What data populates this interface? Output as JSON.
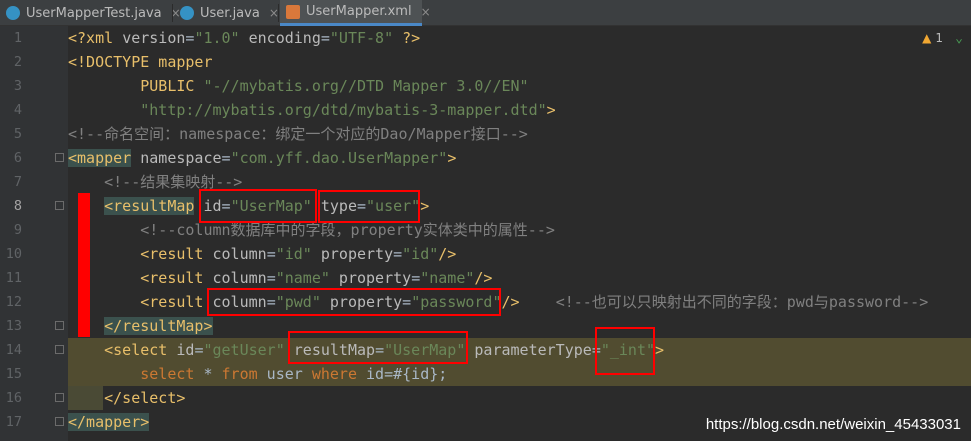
{
  "tabs": [
    {
      "label": "UserMapperTest.java",
      "icon": "java-class-icon",
      "active": false
    },
    {
      "label": "User.java",
      "icon": "java-class-icon",
      "active": false
    },
    {
      "label": "UserMapper.xml",
      "icon": "xml-file-icon",
      "active": true
    }
  ],
  "close_glyph": "×",
  "inspection": {
    "count": "1"
  },
  "line_numbers": [
    "1",
    "2",
    "3",
    "4",
    "5",
    "6",
    "7",
    "8",
    "9",
    "10",
    "11",
    "12",
    "13",
    "14",
    "15",
    "16",
    "17"
  ],
  "code": {
    "l1": {
      "pi_open": "<?xml ",
      "a1": "version",
      "v1": "\"1.0\"",
      "a2": " encoding",
      "v2": "\"UTF-8\"",
      "pi_close": " ?>"
    },
    "l2": {
      "text": "<!DOCTYPE mapper"
    },
    "l3": {
      "indent": "        ",
      "kw": "PUBLIC ",
      "str": "\"-//mybatis.org//DTD Mapper 3.0//EN\""
    },
    "l4": {
      "indent": "        ",
      "str": "\"http://mybatis.org/dtd/mybatis-3-mapper.dtd\"",
      "close": ">"
    },
    "l5": {
      "comment": "<!--命名空间：namespace：绑定一个对应的Dao/Mapper接口-->"
    },
    "l6": {
      "open": "<mapper",
      "attr": " namespace",
      "eq": "=",
      "val": "\"com.yff.dao.UserMapper\"",
      "close": ">"
    },
    "l7": {
      "indent": "    ",
      "comment": "<!--结果集映射-->"
    },
    "l8": {
      "indent": "    ",
      "open": "<resultMap",
      "a1": " id",
      "eq1": "=",
      "v1": "\"UserMap\"",
      "a2": " type",
      "eq2": "=",
      "v2": "\"user\"",
      "close": ">"
    },
    "l9": {
      "indent": "        ",
      "comment": "<!--column数据库中的字段，property实体类中的属性-->"
    },
    "l10": {
      "indent": "        ",
      "open": "<result",
      "a1": " column",
      "eq1": "=",
      "v1": "\"id\"",
      "a2": " property",
      "eq2": "=",
      "v2": "\"id\"",
      "close": "/>"
    },
    "l11": {
      "indent": "        ",
      "open": "<result",
      "a1": " column",
      "eq1": "=",
      "v1": "\"name\"",
      "a2": " property",
      "eq2": "=",
      "v2": "\"name\"",
      "close": "/>"
    },
    "l12": {
      "indent": "        ",
      "open": "<result",
      "a1": " column",
      "eq1": "=",
      "v1": "\"pwd\"",
      "a2": " property",
      "eq2": "=",
      "v2": "\"password\"",
      "close": "/>",
      "gap": "    ",
      "comment": "<!--也可以只映射出不同的字段：pwd与password-->"
    },
    "l13": {
      "indent": "    ",
      "close": "</resultMap>"
    },
    "l14": {
      "indent": "    ",
      "open": "<select",
      "a1": " id",
      "eq1": "=",
      "v1": "\"getUser\"",
      "a2": " resultMap",
      "eq2": "=",
      "v2": "\"UserMap\"",
      "a3": " parameterType",
      "eq3": "=",
      "v3": "\"_int\"",
      "close": ">"
    },
    "l15": {
      "indent": "        ",
      "k1": "select",
      "t1": " * ",
      "k2": "from",
      "t2": " user ",
      "k3": "where",
      "t3": " id=#{id};"
    },
    "l16": {
      "indent": "    ",
      "close": "</select>"
    },
    "l17": {
      "close": "</mapper>"
    }
  },
  "watermark": "https://blog.csdn.net/weixin_45433031",
  "colors": {
    "tag": "#e8bf6a",
    "attr": "#bababa",
    "value": "#6a8759",
    "keyword": "#cc7832",
    "comment": "#808080",
    "annotation": "#ff0000"
  }
}
